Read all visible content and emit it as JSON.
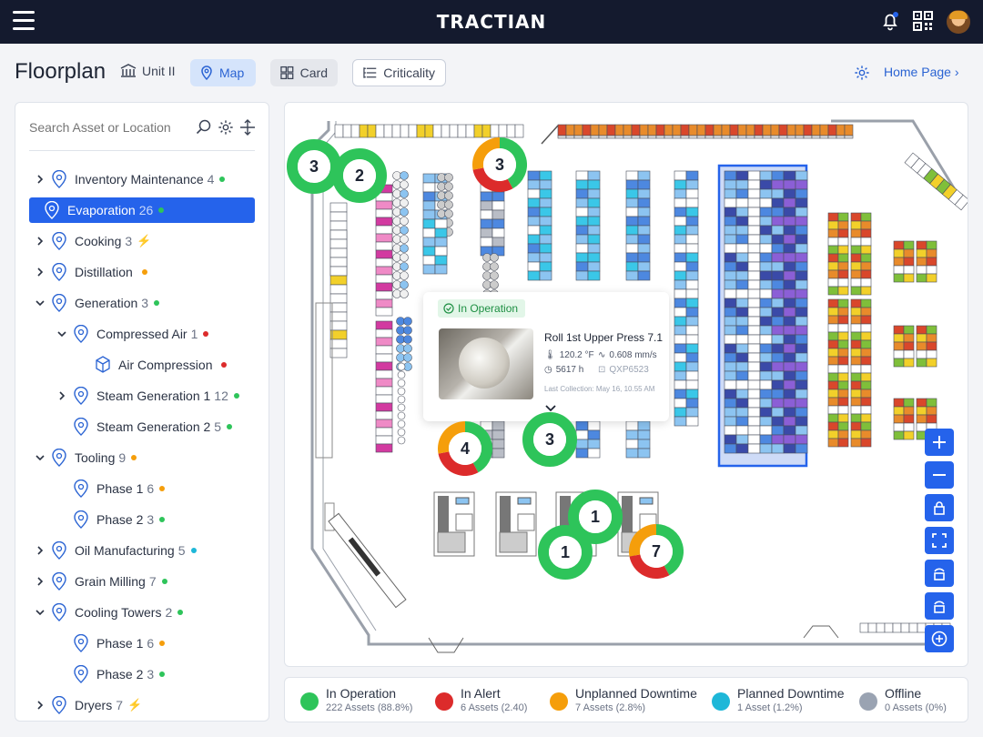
{
  "app": {
    "brand": "TRACTIAN"
  },
  "header": {
    "title": "Floorplan",
    "unit": "Unit II",
    "tabs": {
      "map": "Map",
      "card": "Card",
      "criticality": "Criticality"
    },
    "home_link": "Home Page"
  },
  "sidebar": {
    "search_placeholder": "Search Asset or Location",
    "items": [
      {
        "label": "Inventory Maintenance",
        "count": "4",
        "status": "green"
      },
      {
        "label": "Evaporation",
        "count": "26",
        "status": "green"
      },
      {
        "label": "Cooking",
        "count": "3",
        "status": "bolt-green"
      },
      {
        "label": "Distillation",
        "count": "",
        "status": "orange"
      },
      {
        "label": "Generation",
        "count": "3",
        "status": "green"
      },
      {
        "label": "Compressed Air",
        "count": "1",
        "status": "red"
      },
      {
        "label": "Air Compression",
        "count": "",
        "status": "red"
      },
      {
        "label": "Steam Generation 1",
        "count": "12",
        "status": "green"
      },
      {
        "label": "Steam Generation 2",
        "count": "5",
        "status": "green"
      },
      {
        "label": "Tooling",
        "count": "9",
        "status": "orange"
      },
      {
        "label": "Phase 1",
        "count": "6",
        "status": "orange"
      },
      {
        "label": "Phase 2",
        "count": "3",
        "status": "green"
      },
      {
        "label": "Oil Manufacturing",
        "count": "5",
        "status": "cyan"
      },
      {
        "label": "Grain Milling",
        "count": "7",
        "status": "green"
      },
      {
        "label": "Cooling Towers",
        "count": "2",
        "status": "green"
      },
      {
        "label": "Phase 1",
        "count": "6",
        "status": "orange"
      },
      {
        "label": "Phase 2",
        "count": "3",
        "status": "green"
      },
      {
        "label": "Dryers",
        "count": "7",
        "status": "bolt-red"
      }
    ]
  },
  "popup": {
    "status": "In Operation",
    "asset_name": "Roll 1st Upper Press 7.1",
    "temperature": "120.2 °F",
    "vibration": "0.608 mm/s",
    "hours": "5617 h",
    "sensor_id": "QXP6523",
    "last_collection": "Last Collection: May 16, 10.55 AM"
  },
  "clusters": [
    {
      "count": "3",
      "colors": "green"
    },
    {
      "count": "2",
      "colors": "green"
    },
    {
      "count": "3",
      "colors": "green-red-orange"
    },
    {
      "count": "4",
      "colors": "green-red-orange"
    },
    {
      "count": "3",
      "colors": "green"
    },
    {
      "count": "1",
      "colors": "green"
    },
    {
      "count": "1",
      "colors": "green"
    },
    {
      "count": "7",
      "colors": "green-red-orange"
    }
  ],
  "legend": [
    {
      "label": "In Operation",
      "detail": "222 Assets (88.8%)",
      "color": "#2ec45a"
    },
    {
      "label": "In Alert",
      "detail": "6 Assets (2.40)",
      "color": "#dc2b2b"
    },
    {
      "label": "Unplanned Downtime",
      "detail": "7 Assets (2.8%)",
      "color": "#f59e0b"
    },
    {
      "label": "Planned Downtime",
      "detail": "1 Asset (1.2%)",
      "color": "#1eb7d8"
    },
    {
      "label": "Offline",
      "detail": "0 Assets (0%)",
      "color": "#9aa3b2"
    }
  ],
  "status_colors": {
    "green": "#2ec45a",
    "red": "#dc2b2b",
    "orange": "#f59e0b",
    "cyan": "#1eb7d8",
    "accent": "#2563eb"
  }
}
